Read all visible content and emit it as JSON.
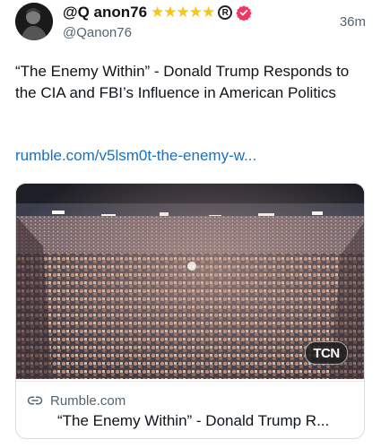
{
  "post": {
    "display_name": "@Q anon76",
    "handle": "@Qanon76",
    "time": "36m",
    "star_count": 5,
    "registered_mark": "R",
    "text": "“The Enemy Within” - Donald Trump Responds to the CIA and FBI’s Influence in American Politics",
    "link": "rumble.com/v5lsm0t-the-enemy-w..."
  },
  "card": {
    "domain": "Rumble.com",
    "title": "“The Enemy Within” - Donald Trump R...",
    "watermark": "TCN"
  },
  "colors": {
    "star": "#f5c518",
    "verified_badge": "#f0385f",
    "link": "#1d6fb8",
    "secondary_text": "#536471"
  },
  "icons": [
    "star-icon",
    "registered-icon",
    "verified-badge-icon",
    "link-icon"
  ]
}
